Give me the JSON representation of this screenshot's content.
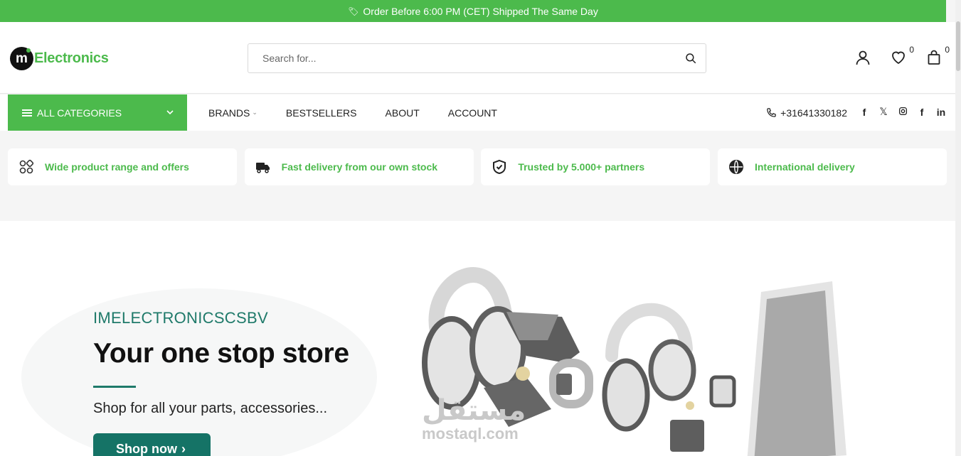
{
  "topbar": {
    "message": "Order Before 6:00 PM (CET) Shipped The Same Day"
  },
  "header": {
    "logo_mark": "m",
    "logo_word": "Electronics",
    "search_placeholder": "Search for...",
    "wishlist_count": "0",
    "cart_count": "0"
  },
  "nav": {
    "all_categories": "ALL CATEGORIES",
    "items": [
      {
        "label": "BRANDS",
        "has_dropdown": true
      },
      {
        "label": "BESTSELLERS"
      },
      {
        "label": "ABOUT"
      },
      {
        "label": "ACCOUNT"
      }
    ],
    "phone": "+31641330182",
    "social": [
      "facebook-icon",
      "x-icon",
      "instagram-icon",
      "facebook-icon",
      "linkedin-icon"
    ]
  },
  "features": [
    {
      "icon": "grid-circles-icon",
      "label": "Wide product range and offers"
    },
    {
      "icon": "truck-icon",
      "label": "Fast delivery from our own stock"
    },
    {
      "icon": "shield-check-icon",
      "label": "Trusted by 5.000+ partners"
    },
    {
      "icon": "globe-icon",
      "label": "International delivery"
    }
  ],
  "hero": {
    "brand": "IMELECTRONICSCSBV",
    "title": "Your one stop store",
    "subtitle": "Shop for all your parts, accessories...",
    "cta": "Shop now"
  },
  "watermark": {
    "arabic": "مستقل",
    "latin": "mostaql.com"
  },
  "colors": {
    "brand_green": "#4cba4c",
    "teal": "#157366",
    "teal_text": "#1f7a6a"
  }
}
